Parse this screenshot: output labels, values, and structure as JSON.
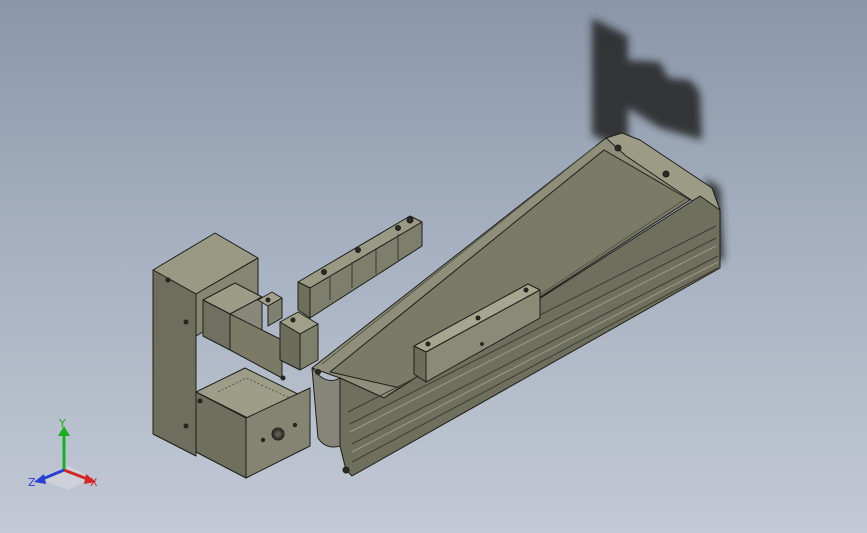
{
  "viewport": {
    "background_top": "#8a97a9",
    "background_bottom": "#c3c9d5"
  },
  "model": {
    "part_color": "#7d7d69",
    "edge_color": "#1e1e1a",
    "shadow_color": "#202020"
  },
  "triad": {
    "x_label": "X",
    "y_label": "Y",
    "z_label": "Z",
    "x_color": "#d22828",
    "y_color": "#18b020",
    "z_color": "#2840d0"
  }
}
